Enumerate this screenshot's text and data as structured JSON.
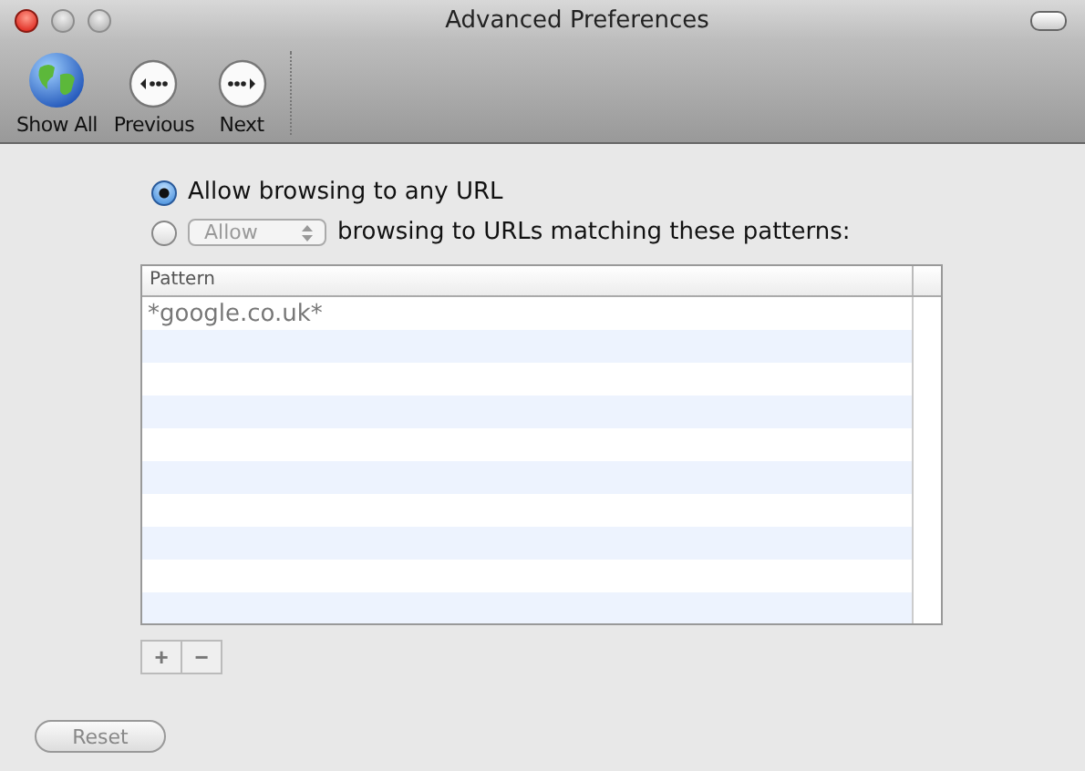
{
  "window": {
    "title": "Advanced Preferences"
  },
  "toolbar": [
    {
      "label": "Show All",
      "kind": "globe"
    },
    {
      "label": "Previous",
      "kind": "back"
    },
    {
      "label": "Next",
      "kind": "forward"
    }
  ],
  "options": [
    {
      "kind": "plain",
      "label": "Allow browsing to any URL",
      "selected": true
    },
    {
      "kind": "popup",
      "popup": {
        "value": "Allow",
        "disabled": true
      },
      "label": "browsing to URLs matching these patterns:",
      "selected": false
    }
  ],
  "table": {
    "columns": [
      "Pattern"
    ],
    "rows": [
      [
        "*google.co.uk*"
      ]
    ]
  },
  "table_buttons": [
    "+",
    "−"
  ],
  "reset_button": {
    "label": "Reset",
    "disabled": true
  }
}
